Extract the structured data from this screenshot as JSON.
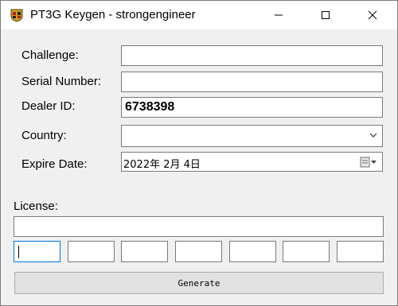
{
  "window": {
    "title": "PT3G Keygen - strongengineer",
    "app_icon": "porsche-crest-icon",
    "controls": [
      "minimize-icon",
      "maximize-icon",
      "close-icon"
    ]
  },
  "form": {
    "challenge": {
      "label": "Challenge:",
      "value": ""
    },
    "serial_number": {
      "label": "Serial Number:",
      "value": ""
    },
    "dealer_id": {
      "label": "Dealer ID:",
      "value": "6738398"
    },
    "country": {
      "label": "Country:",
      "selected": ""
    },
    "expire_date": {
      "label": "Expire Date:",
      "value": "2022年 2月 4日"
    }
  },
  "license": {
    "label": "License:",
    "value": "",
    "segments": [
      "",
      "",
      "",
      "",
      "",
      "",
      ""
    ]
  },
  "generate": {
    "label": "Generate"
  },
  "colors": {
    "focus_border": "#0078d7",
    "field_border": "#7a7a7a",
    "window_bg": "#f0f0f0"
  }
}
